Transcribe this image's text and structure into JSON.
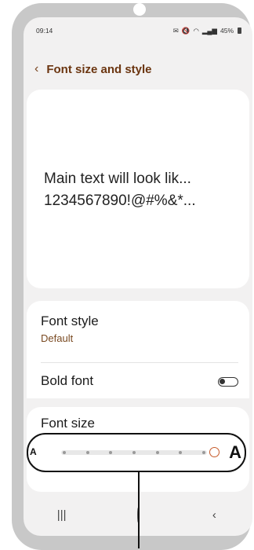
{
  "status_bar": {
    "time": "09:14",
    "icons": [
      "notification-icon",
      "mute-icon",
      "wifi-icon",
      "signal-icon"
    ],
    "battery": "45%"
  },
  "header": {
    "back_icon": "chevron-left-icon",
    "title": "Font size and style"
  },
  "preview": {
    "line1": "Main text will look lik...",
    "line2": "1234567890!@#%&*..."
  },
  "font_style": {
    "label": "Font style",
    "value": "Default"
  },
  "bold_font": {
    "label": "Bold font",
    "enabled": false
  },
  "font_size": {
    "label": "Font size",
    "small_label": "A",
    "large_label": "A",
    "steps": 8,
    "selected_step": 8,
    "accent_color": "#c65a2a"
  },
  "nav_bar": {
    "items": [
      "recents-icon",
      "home-icon",
      "back-icon"
    ]
  },
  "colors": {
    "title": "#6b3510",
    "subtitle": "#7a4a22",
    "background": "#f2f1f1"
  }
}
